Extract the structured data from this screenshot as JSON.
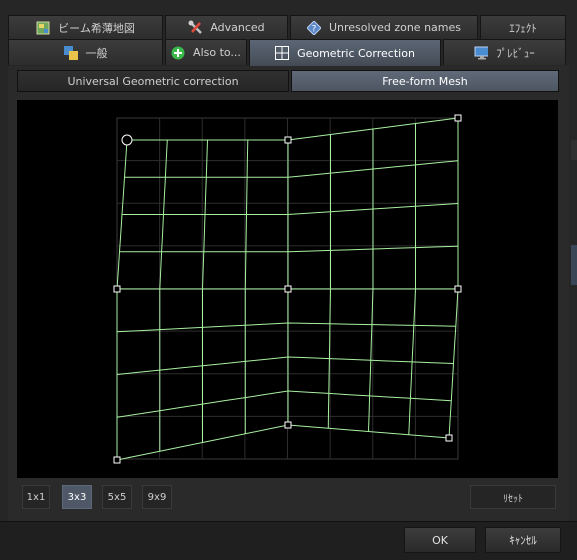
{
  "tabs_row1": [
    {
      "label": "ビーム希薄地図",
      "icon": "map-icon"
    },
    {
      "label": "Advanced",
      "icon": "wrench-icon"
    },
    {
      "label": "Unresolved zone names",
      "icon": "info-diamond-icon"
    },
    {
      "label": "ｴﾌｪｸﾄ",
      "icon": ""
    }
  ],
  "tabs_row2": [
    {
      "label": "一般",
      "icon": "general-settings-icon"
    },
    {
      "label": "Also to...",
      "icon": "plus-circle-icon"
    },
    {
      "label": "Geometric Correction",
      "icon": "grid-icon"
    },
    {
      "label": "ﾌﾟﾚﾋﾞｭｰ",
      "icon": "monitor-icon"
    }
  ],
  "mode_tabs": {
    "universal": "Universal Geometric correction",
    "freeform": "Free-form Mesh",
    "selected": "freeform"
  },
  "grid_options": [
    "1x1",
    "3x3",
    "5x5",
    "9x9"
  ],
  "selected_grid": "3x3",
  "reset_label": "ﾘｾｯﾄ",
  "ok_label": "OK",
  "cancel_label": "ｷｬﾝｾﾙ",
  "colors": {
    "mesh": "#a8f0a0",
    "accent": "#4e5866"
  }
}
